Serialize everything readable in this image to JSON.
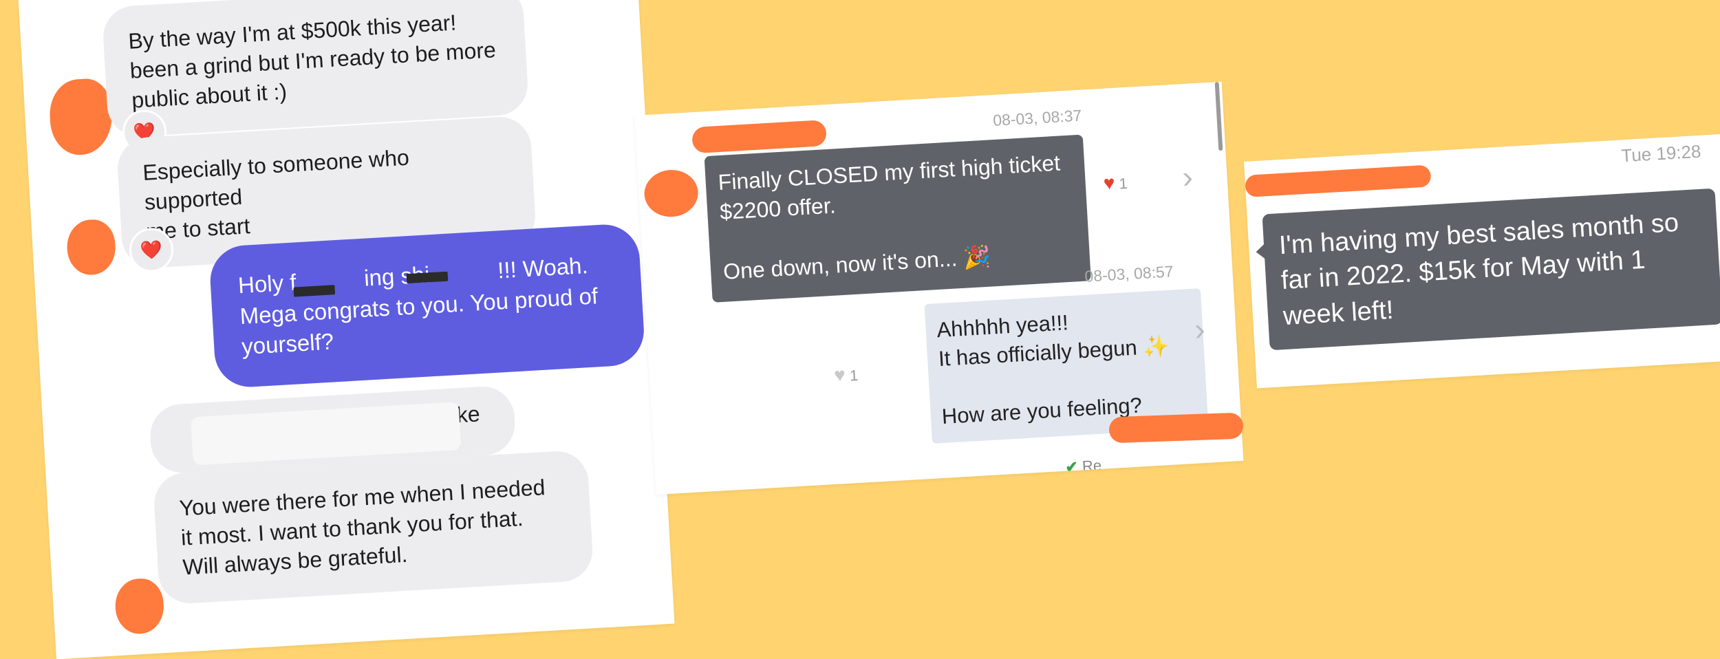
{
  "card1": {
    "msg1": "By the way I'm at $500k this year!\nbeen a grind but I'm ready to be more\npublic about it :)",
    "msg2": "Especially to someone who supported\nme to start",
    "msg3": "Holy f   ing shi   !!! Woah.\nMega congrats to you. You proud of\nyourself?",
    "msg4_fragment": "like",
    "msg5": "You were there for me when I needed\nit most. I want to thank you for that.\nWill always be grateful.",
    "reaction": "❤️"
  },
  "card2": {
    "timestamp1": "08-03, 08:37",
    "msg1": "Finally CLOSED my first high ticket\n$2200 offer.\n\nOne down, now it's on... 🎉",
    "like_count1": "1",
    "timestamp2": "08-03, 08:57",
    "msg2": "Ahhhhh yea!!!\nIt has officially begun ✨\n\nHow are you feeling?",
    "like_count2": "1",
    "read_label": "Re",
    "accent_heart": "#E8402D"
  },
  "card3": {
    "timestamp": "Tue 19:28",
    "msg1": "I'm having my best sales month so\nfar in 2022. $15k for May with 1\nweek left!"
  }
}
